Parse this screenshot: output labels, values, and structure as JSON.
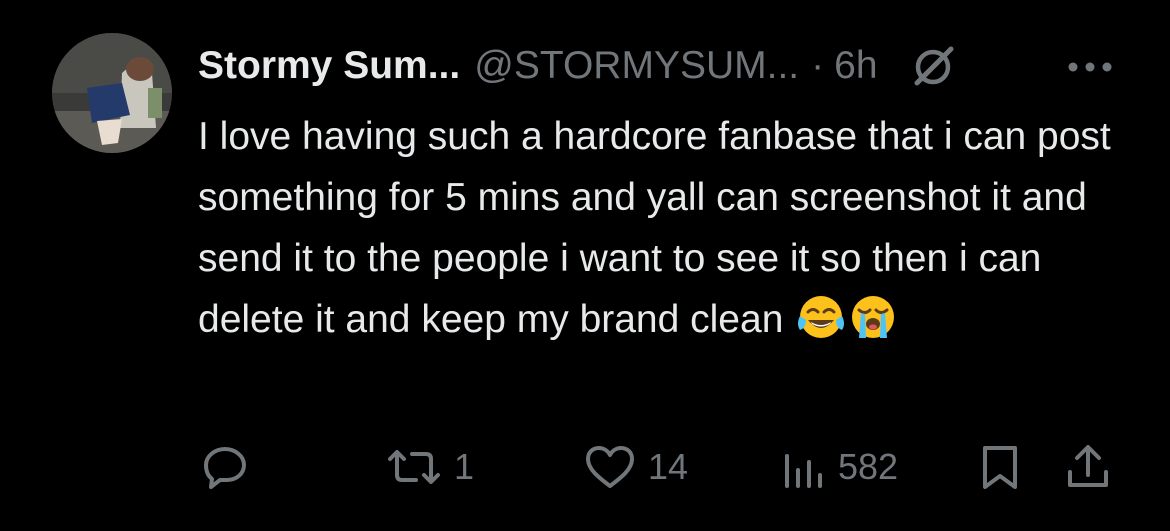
{
  "tweet": {
    "display_name": "Stormy Sum...",
    "handle": "@STORMYSUM...",
    "separator": "·",
    "time": "6h",
    "text": "I love having such a hardcore fanbase that i can post something for 5 mins and yall can screenshot it and send it to the people i want to see it so then i can delete it and keep my brand clean",
    "emojis": [
      "face-with-tears-of-joy",
      "loudly-crying-face"
    ]
  },
  "actions": {
    "reply_count": "",
    "retweet_count": "1",
    "like_count": "14",
    "views_count": "582"
  },
  "icons": {
    "grok": "grok-icon",
    "more": "more-icon",
    "reply": "reply-icon",
    "retweet": "retweet-icon",
    "like": "heart-icon",
    "views": "views-icon",
    "bookmark": "bookmark-icon",
    "share": "share-icon"
  },
  "colors": {
    "background": "#000000",
    "primary_text": "#e7e9ea",
    "secondary_text": "#71767b"
  }
}
